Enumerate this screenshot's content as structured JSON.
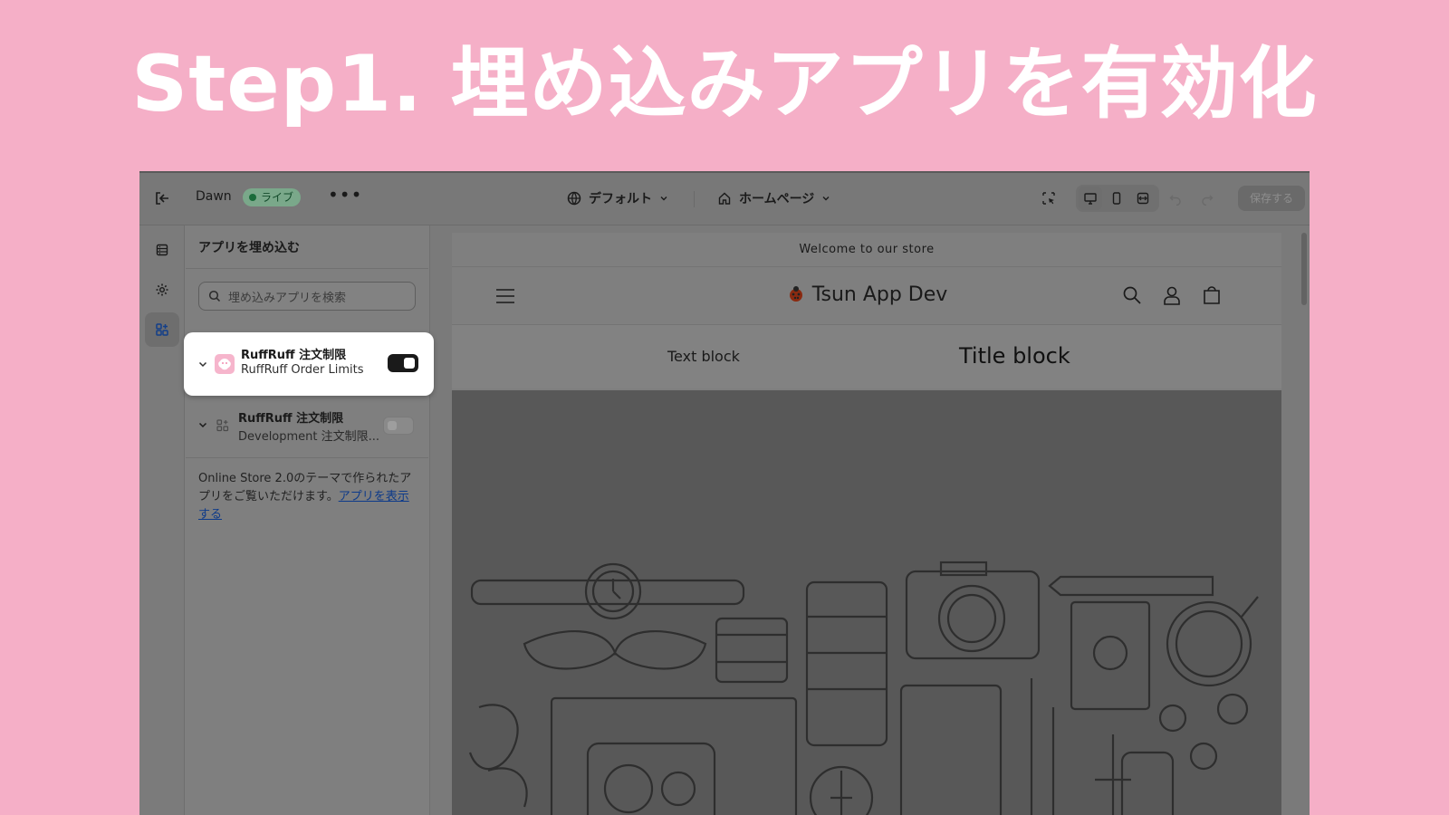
{
  "headline": "Step1. 埋め込みアプリを有効化",
  "topbar": {
    "theme_name": "Dawn",
    "live_badge": "ライブ",
    "more": "•••",
    "locale": "デフォルト",
    "page": "ホームページ",
    "save": "保存する"
  },
  "panel": {
    "title": "アプリを埋め込む",
    "search_placeholder": "埋め込みアプリを検索",
    "apps": [
      {
        "title": "RuffRuff 注文制限",
        "subtitle": "RuffRuff Order Limits",
        "enabled": true
      },
      {
        "title": "RuffRuff 注文制限",
        "subtitle": "Development 注文制限...",
        "enabled": false
      }
    ],
    "info_text": "Online Store 2.0のテーマで作られたアプリをご覧いただけます。",
    "info_link": "アプリを表示する"
  },
  "preview": {
    "announcement": "Welcome to our store",
    "store_name": "Tsun App Dev",
    "text_block": "Text block",
    "title_block": "Title block"
  },
  "colors": {
    "background": "#f5afc7",
    "accent_app_icon": "#f28cb0"
  }
}
